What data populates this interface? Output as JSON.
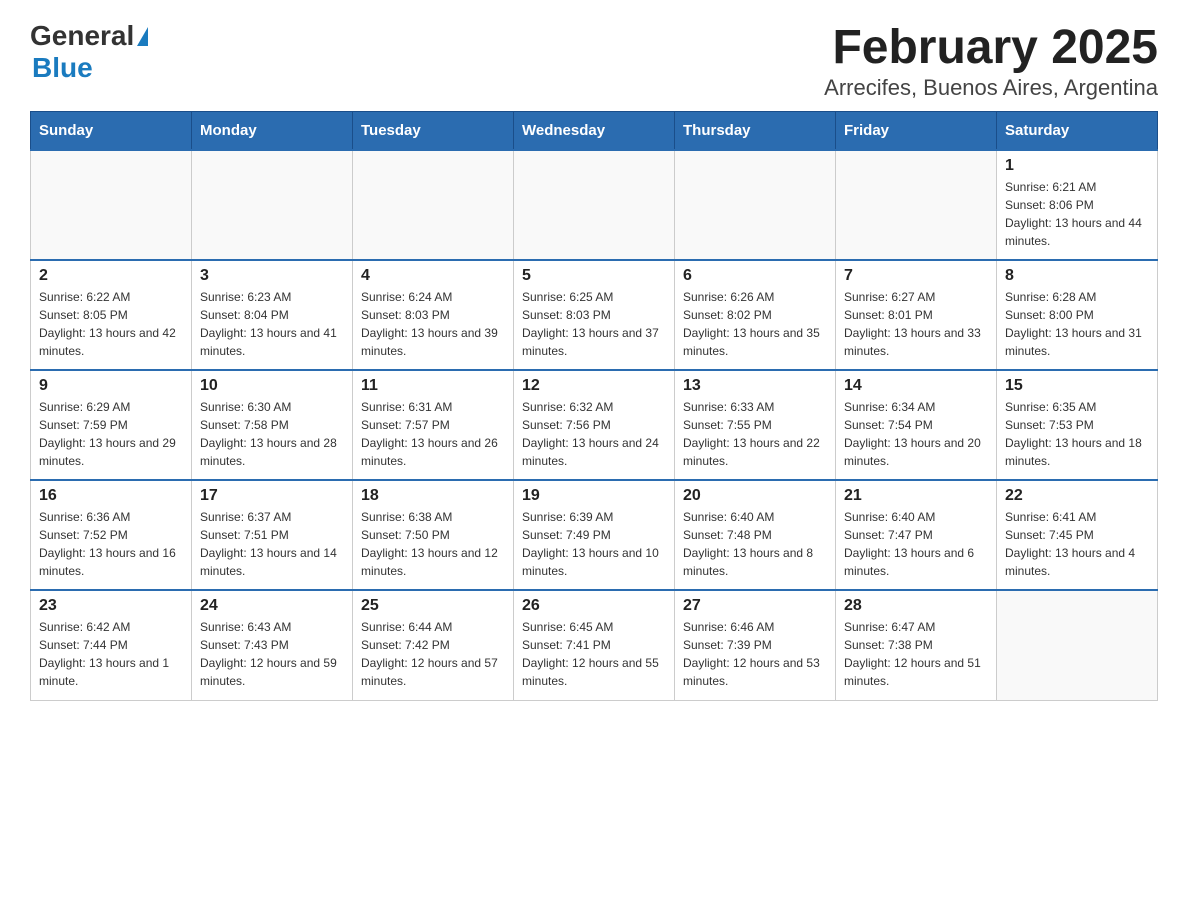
{
  "header": {
    "logo_general": "General",
    "logo_blue": "Blue",
    "title": "February 2025",
    "subtitle": "Arrecifes, Buenos Aires, Argentina"
  },
  "days_of_week": [
    "Sunday",
    "Monday",
    "Tuesday",
    "Wednesday",
    "Thursday",
    "Friday",
    "Saturday"
  ],
  "weeks": [
    [
      {
        "day": "",
        "info": ""
      },
      {
        "day": "",
        "info": ""
      },
      {
        "day": "",
        "info": ""
      },
      {
        "day": "",
        "info": ""
      },
      {
        "day": "",
        "info": ""
      },
      {
        "day": "",
        "info": ""
      },
      {
        "day": "1",
        "info": "Sunrise: 6:21 AM\nSunset: 8:06 PM\nDaylight: 13 hours and 44 minutes."
      }
    ],
    [
      {
        "day": "2",
        "info": "Sunrise: 6:22 AM\nSunset: 8:05 PM\nDaylight: 13 hours and 42 minutes."
      },
      {
        "day": "3",
        "info": "Sunrise: 6:23 AM\nSunset: 8:04 PM\nDaylight: 13 hours and 41 minutes."
      },
      {
        "day": "4",
        "info": "Sunrise: 6:24 AM\nSunset: 8:03 PM\nDaylight: 13 hours and 39 minutes."
      },
      {
        "day": "5",
        "info": "Sunrise: 6:25 AM\nSunset: 8:03 PM\nDaylight: 13 hours and 37 minutes."
      },
      {
        "day": "6",
        "info": "Sunrise: 6:26 AM\nSunset: 8:02 PM\nDaylight: 13 hours and 35 minutes."
      },
      {
        "day": "7",
        "info": "Sunrise: 6:27 AM\nSunset: 8:01 PM\nDaylight: 13 hours and 33 minutes."
      },
      {
        "day": "8",
        "info": "Sunrise: 6:28 AM\nSunset: 8:00 PM\nDaylight: 13 hours and 31 minutes."
      }
    ],
    [
      {
        "day": "9",
        "info": "Sunrise: 6:29 AM\nSunset: 7:59 PM\nDaylight: 13 hours and 29 minutes."
      },
      {
        "day": "10",
        "info": "Sunrise: 6:30 AM\nSunset: 7:58 PM\nDaylight: 13 hours and 28 minutes."
      },
      {
        "day": "11",
        "info": "Sunrise: 6:31 AM\nSunset: 7:57 PM\nDaylight: 13 hours and 26 minutes."
      },
      {
        "day": "12",
        "info": "Sunrise: 6:32 AM\nSunset: 7:56 PM\nDaylight: 13 hours and 24 minutes."
      },
      {
        "day": "13",
        "info": "Sunrise: 6:33 AM\nSunset: 7:55 PM\nDaylight: 13 hours and 22 minutes."
      },
      {
        "day": "14",
        "info": "Sunrise: 6:34 AM\nSunset: 7:54 PM\nDaylight: 13 hours and 20 minutes."
      },
      {
        "day": "15",
        "info": "Sunrise: 6:35 AM\nSunset: 7:53 PM\nDaylight: 13 hours and 18 minutes."
      }
    ],
    [
      {
        "day": "16",
        "info": "Sunrise: 6:36 AM\nSunset: 7:52 PM\nDaylight: 13 hours and 16 minutes."
      },
      {
        "day": "17",
        "info": "Sunrise: 6:37 AM\nSunset: 7:51 PM\nDaylight: 13 hours and 14 minutes."
      },
      {
        "day": "18",
        "info": "Sunrise: 6:38 AM\nSunset: 7:50 PM\nDaylight: 13 hours and 12 minutes."
      },
      {
        "day": "19",
        "info": "Sunrise: 6:39 AM\nSunset: 7:49 PM\nDaylight: 13 hours and 10 minutes."
      },
      {
        "day": "20",
        "info": "Sunrise: 6:40 AM\nSunset: 7:48 PM\nDaylight: 13 hours and 8 minutes."
      },
      {
        "day": "21",
        "info": "Sunrise: 6:40 AM\nSunset: 7:47 PM\nDaylight: 13 hours and 6 minutes."
      },
      {
        "day": "22",
        "info": "Sunrise: 6:41 AM\nSunset: 7:45 PM\nDaylight: 13 hours and 4 minutes."
      }
    ],
    [
      {
        "day": "23",
        "info": "Sunrise: 6:42 AM\nSunset: 7:44 PM\nDaylight: 13 hours and 1 minute."
      },
      {
        "day": "24",
        "info": "Sunrise: 6:43 AM\nSunset: 7:43 PM\nDaylight: 12 hours and 59 minutes."
      },
      {
        "day": "25",
        "info": "Sunrise: 6:44 AM\nSunset: 7:42 PM\nDaylight: 12 hours and 57 minutes."
      },
      {
        "day": "26",
        "info": "Sunrise: 6:45 AM\nSunset: 7:41 PM\nDaylight: 12 hours and 55 minutes."
      },
      {
        "day": "27",
        "info": "Sunrise: 6:46 AM\nSunset: 7:39 PM\nDaylight: 12 hours and 53 minutes."
      },
      {
        "day": "28",
        "info": "Sunrise: 6:47 AM\nSunset: 7:38 PM\nDaylight: 12 hours and 51 minutes."
      },
      {
        "day": "",
        "info": ""
      }
    ]
  ]
}
